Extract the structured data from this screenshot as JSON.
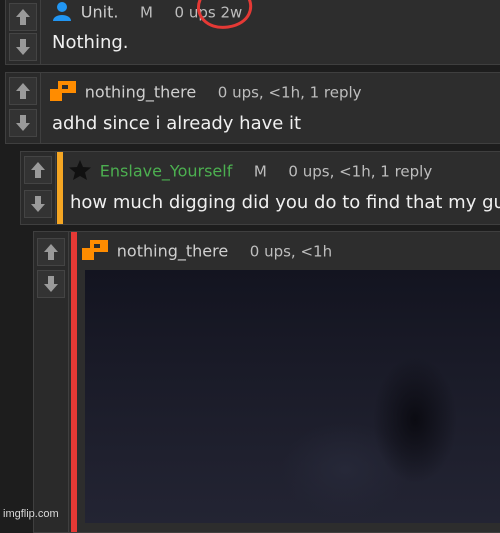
{
  "comments": [
    {
      "user": "Unit.",
      "mod": "M",
      "ups": "0 ups",
      "age": "2w",
      "replies": "",
      "body": "Nothing.",
      "user_color": "#cfcfcf",
      "icon": "user-icon"
    },
    {
      "user": "nothing_there",
      "mod": "",
      "ups": "0 ups, <1h, 1 reply",
      "age": "",
      "replies": "",
      "body": "adhd since i already have it",
      "user_color": "#cfcfcf",
      "icon": "pixel-logo-icon"
    },
    {
      "user": "Enslave_Yourself",
      "mod": "M",
      "ups": "0 ups, <1h, 1 reply",
      "age": "",
      "replies": "",
      "body": "how much digging did you do to find that my guy",
      "user_color": "#4caf50",
      "icon": "star-icon",
      "bar_color": "#f5a623"
    },
    {
      "user": "nothing_there",
      "mod": "",
      "ups": "0 ups, <1h",
      "age": "",
      "replies": "",
      "body": "",
      "user_color": "#cfcfcf",
      "icon": "pixel-logo-icon",
      "bar_color": "#e53935"
    }
  ],
  "watermark": "imgflip.com",
  "colors": {
    "accent_orange": "#ff8c00",
    "red_annotation": "#e53935",
    "background": "#1d1d1d",
    "panel": "#2d2d2d"
  }
}
